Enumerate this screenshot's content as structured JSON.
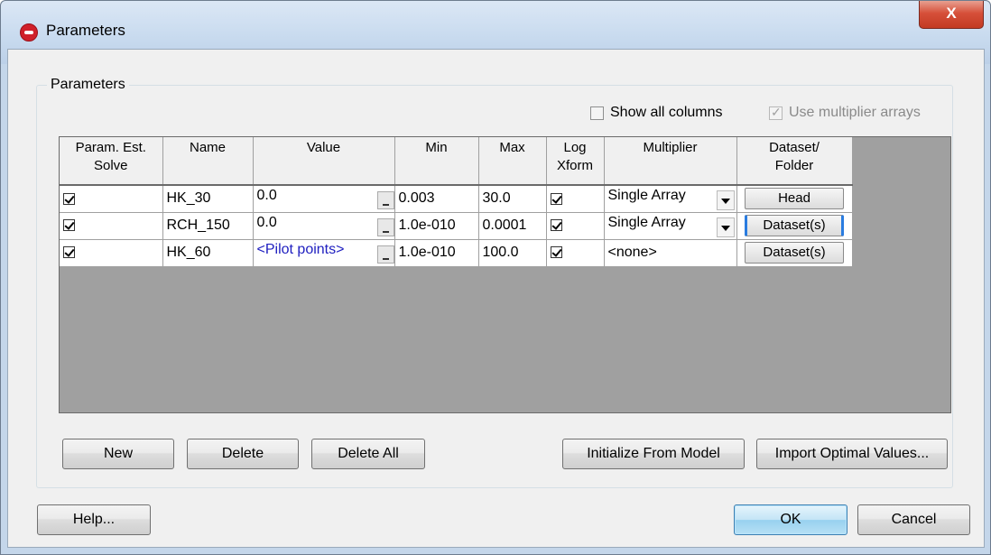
{
  "window": {
    "title": "Parameters",
    "close_label": "X"
  },
  "group": {
    "label": "Parameters"
  },
  "options": {
    "show_all_columns": {
      "label": "Show all columns",
      "checked": false
    },
    "use_multiplier_arrays": {
      "label": "Use multiplier arrays",
      "checked": true,
      "disabled": true
    }
  },
  "table": {
    "headers": {
      "solve": [
        "Param. Est.",
        "Solve"
      ],
      "name": "Name",
      "value": "Value",
      "min": "Min",
      "max": "Max",
      "log": [
        "Log",
        "Xform"
      ],
      "multiplier": "Multiplier",
      "dataset": [
        "Dataset/",
        "Folder"
      ]
    },
    "rows": [
      {
        "solve": true,
        "name": "HK_30",
        "value": "0.0",
        "min": "0.003",
        "max": "30.0",
        "log": true,
        "multiplier": "Single Array",
        "dataset": "Head"
      },
      {
        "solve": true,
        "name": "RCH_150",
        "value": "0.0",
        "min": "1.0e-010",
        "max": "0.0001",
        "log": true,
        "multiplier": "Single Array",
        "dataset": "Dataset(s)"
      },
      {
        "solve": true,
        "name": "HK_60",
        "value": "<Pilot points>",
        "min": "1.0e-010",
        "max": "100.0",
        "log": true,
        "multiplier": "<none>",
        "dataset": "Dataset(s)"
      }
    ]
  },
  "buttons": {
    "new": "New",
    "delete": "Delete",
    "delete_all": "Delete All",
    "initialize": "Initialize From Model",
    "import_optimal": "Import Optimal Values...",
    "help": "Help...",
    "ok": "OK",
    "cancel": "Cancel"
  },
  "icons": {
    "app": "gms-app-icon",
    "close": "close-icon",
    "spin": "spinner-icon",
    "dropdown": "chevron-down-icon"
  }
}
